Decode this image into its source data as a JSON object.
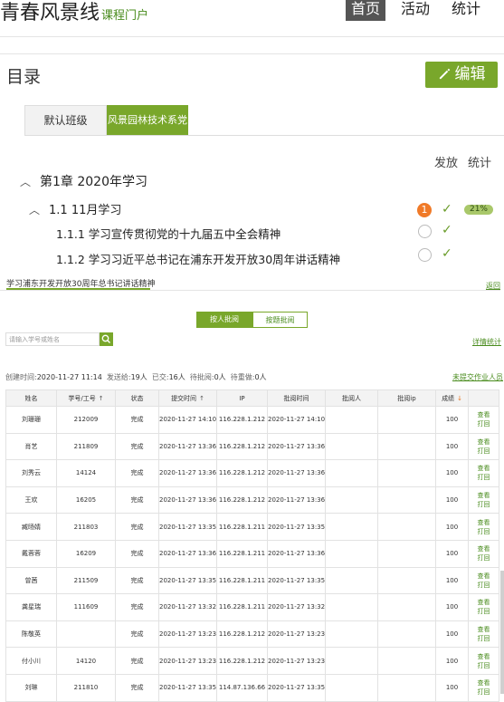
{
  "header": {
    "brand": "青春风景线",
    "brand_sub": "课程门户",
    "nav": [
      "首页",
      "活动",
      "统计"
    ]
  },
  "catalog": {
    "title": "目录",
    "edit_label": "编辑",
    "tabs": [
      "默认班级",
      "风景园林技术系党"
    ],
    "col_publish": "发放",
    "col_stats": "统计",
    "chapter": "第1章 2020年学习",
    "section": "1.1  11月学习",
    "section_badge": "1",
    "section_percent": "21%",
    "items": [
      "1.1.1 学习宣传贯彻党的十九届五中全会精神",
      "1.1.2 学习习近平总书记在浦东开发开放30周年讲话精神"
    ]
  },
  "assignment": {
    "title": "学习浦东开发开放30周年总书记讲话精神",
    "back": "返回",
    "segments": [
      "按人批阅",
      "按题批阅"
    ],
    "search_placeholder": "请输入学号或姓名",
    "detail_stats": "详情统计",
    "meta": {
      "created_label": "创建时间:",
      "created": "2020-11-27 11:14",
      "sent_label": "发送给:",
      "sent": "19人",
      "submitted_label": "已交:",
      "submitted": "16人",
      "pending_label": "待批阅:",
      "pending": "0人",
      "redo_label": "待重做:",
      "redo": "0人"
    },
    "unsubmitted": "未提交作业人员",
    "columns": [
      "姓名",
      "学号/工号",
      "状态",
      "提交时间",
      "IP",
      "批阅时间",
      "批阅人",
      "批阅ip",
      "成绩"
    ],
    "ops": [
      "查看",
      "打回"
    ],
    "rows": [
      {
        "name": "刘珊珊",
        "id": "212009",
        "status": "完成",
        "submit": "2020-11-27 14:10",
        "ip": "116.228.1.212",
        "review": "2020-11-27 14:10",
        "reviewer": "",
        "review_ip": "",
        "score": "100"
      },
      {
        "name": "肖艺",
        "id": "211809",
        "status": "完成",
        "submit": "2020-11-27 13:36",
        "ip": "116.228.1.212",
        "review": "2020-11-27 13:36",
        "reviewer": "",
        "review_ip": "",
        "score": "100"
      },
      {
        "name": "刘秀云",
        "id": "14124",
        "status": "完成",
        "submit": "2020-11-27 13:36",
        "ip": "116.228.1.212",
        "review": "2020-11-27 13:36",
        "reviewer": "",
        "review_ip": "",
        "score": "100"
      },
      {
        "name": "王欢",
        "id": "16205",
        "status": "完成",
        "submit": "2020-11-27 13:36",
        "ip": "116.228.1.212",
        "review": "2020-11-27 13:36",
        "reviewer": "",
        "review_ip": "",
        "score": "100"
      },
      {
        "name": "臧旸婧",
        "id": "211803",
        "status": "完成",
        "submit": "2020-11-27 13:35",
        "ip": "116.228.1.211",
        "review": "2020-11-27 13:35",
        "reviewer": "",
        "review_ip": "",
        "score": "100"
      },
      {
        "name": "戴蓉蓉",
        "id": "16209",
        "status": "完成",
        "submit": "2020-11-27 13:36",
        "ip": "116.228.1.211",
        "review": "2020-11-27 13:36",
        "reviewer": "",
        "review_ip": "",
        "score": "100"
      },
      {
        "name": "曾茜",
        "id": "211509",
        "status": "完成",
        "submit": "2020-11-27 13:35",
        "ip": "116.228.1.211",
        "review": "2020-11-27 13:35",
        "reviewer": "",
        "review_ip": "",
        "score": "100"
      },
      {
        "name": "龚星瑞",
        "id": "111609",
        "status": "完成",
        "submit": "2020-11-27 13:32",
        "ip": "116.228.1.211",
        "review": "2020-11-27 13:32",
        "reviewer": "",
        "review_ip": "",
        "score": "100"
      },
      {
        "name": "陈敬英",
        "id": "",
        "status": "完成",
        "submit": "2020-11-27 13:23",
        "ip": "116.228.1.212",
        "review": "2020-11-27 13:23",
        "reviewer": "",
        "review_ip": "",
        "score": "100"
      },
      {
        "name": "付小川",
        "id": "14120",
        "status": "完成",
        "submit": "2020-11-27 13:23",
        "ip": "116.228.1.212",
        "review": "2020-11-27 13:23",
        "reviewer": "",
        "review_ip": "",
        "score": "100"
      },
      {
        "name": "刘琳",
        "id": "211810",
        "status": "完成",
        "submit": "2020-11-27 13:35",
        "ip": "114.87.136.66",
        "review": "2020-11-27 13:35",
        "reviewer": "",
        "review_ip": "",
        "score": "100"
      }
    ]
  },
  "colors": {
    "accent": "#79a72b",
    "badge": "#f07a28"
  }
}
